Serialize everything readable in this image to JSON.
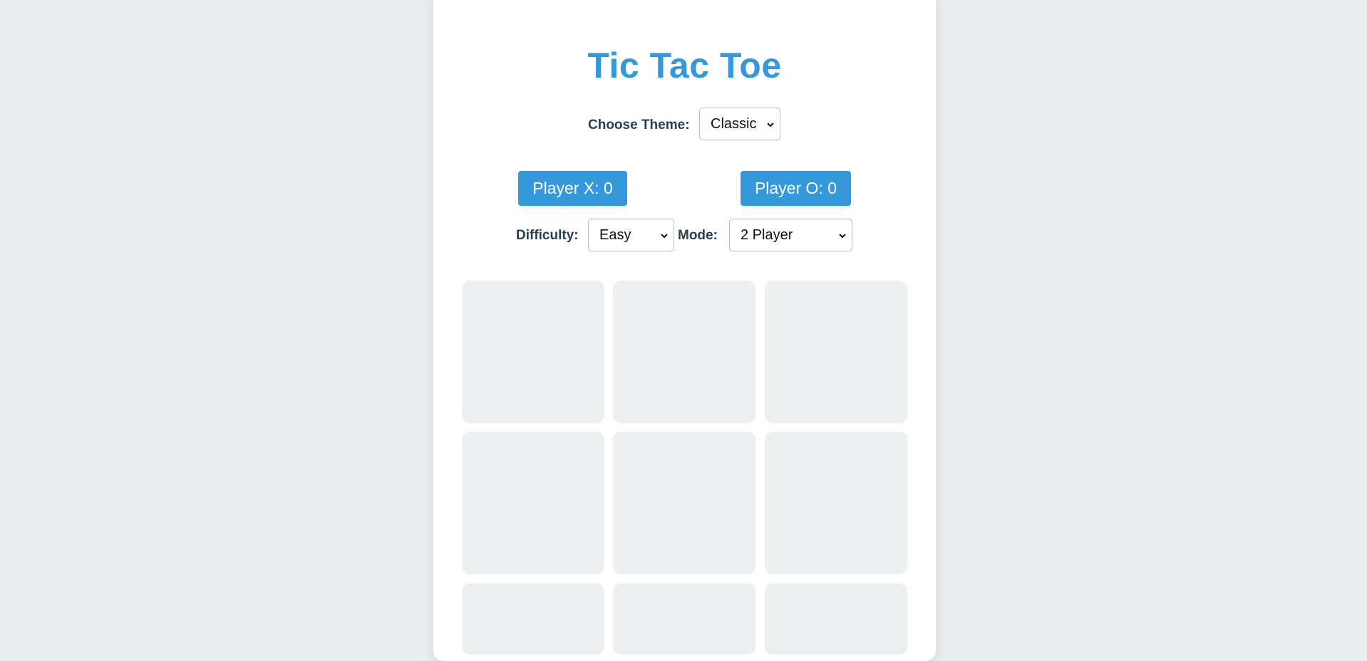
{
  "title": "Tic Tac Toe",
  "theme": {
    "label": "Choose Theme:",
    "selected": "Classic"
  },
  "scores": {
    "player_x": "Player X: 0",
    "player_o": "Player O: 0"
  },
  "difficulty": {
    "label": "Difficulty:",
    "selected": "Easy"
  },
  "mode": {
    "label": "Mode:",
    "selected": "2 Player"
  },
  "board": {
    "cells": [
      "",
      "",
      "",
      "",
      "",
      "",
      "",
      "",
      ""
    ]
  },
  "colors": {
    "accent": "#3498db",
    "label_text": "#2c3e50",
    "cell_bg": "#ecf0f1",
    "page_bg": "#eaeef0"
  },
  "icons": {
    "select_arrow": "chevron-down-icon"
  }
}
